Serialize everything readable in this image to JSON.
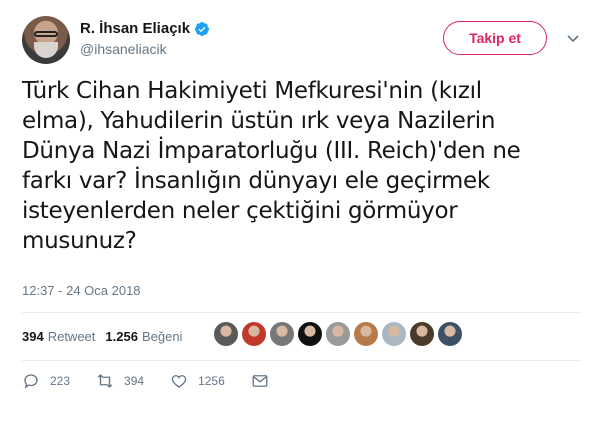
{
  "user": {
    "display_name": "R. İhsan Eliaçık",
    "handle": "@ihsaneliacik",
    "verified": true
  },
  "follow_button": {
    "label": "Takip et",
    "color": "#e0245e"
  },
  "tweet": {
    "text": "Türk Cihan Hakimiyeti Mefkuresi'nin (kızıl\nelma), Yahudilerin üstün ırk veya Nazilerin\nDünya Nazi İmparatorluğu (III. Reich)'den ne\nfarkı var? İnsanlığın dünyayı ele geçirmek\nisteyenlerden neler çektiğini görmüyor\nmusunuz?",
    "timestamp": "12:37 - 24 Oca 2018"
  },
  "stats": {
    "retweet_count": "394",
    "retweet_label": "Retweet",
    "like_count": "1.256",
    "like_label": "Beğeni"
  },
  "likers": [
    {
      "icon": "avatar-liker-1",
      "color": "#5a5a5a"
    },
    {
      "icon": "avatar-liker-2",
      "color": "#c0392b"
    },
    {
      "icon": "avatar-liker-3",
      "color": "#777777"
    },
    {
      "icon": "avatar-liker-4",
      "color": "#111111"
    },
    {
      "icon": "avatar-liker-5",
      "color": "#9a9a9a"
    },
    {
      "icon": "avatar-liker-6",
      "color": "#b77a4a"
    },
    {
      "icon": "avatar-liker-7",
      "color": "#aab8c2"
    },
    {
      "icon": "avatar-liker-8",
      "color": "#4a3b2a"
    },
    {
      "icon": "avatar-liker-9",
      "color": "#3d5066"
    }
  ],
  "actions": {
    "reply_count": "223",
    "retweet_count": "394",
    "like_count": "1256"
  },
  "colors": {
    "text_secondary": "#657786",
    "verified_blue": "#1da1f2",
    "divider": "#e6ecf0"
  }
}
